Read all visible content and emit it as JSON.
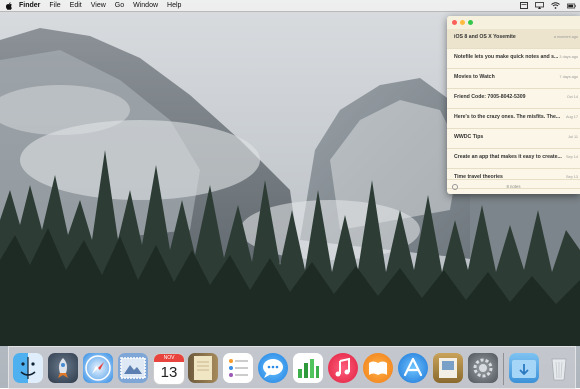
{
  "menubar": {
    "app_name": "Finder",
    "menus": [
      "File",
      "Edit",
      "View",
      "Go",
      "Window",
      "Help"
    ]
  },
  "notefile": {
    "notes": [
      {
        "title": "iOS 8 and OS X Yosemite",
        "date": "a moment ago"
      },
      {
        "title": "Notefile lets you make quick notes and s...",
        "date": "3 days ago"
      },
      {
        "title": "Movies to Watch",
        "date": "7 days ago"
      },
      {
        "title": "Friend Code: 7005-8042-5309",
        "date": "Oct 14"
      },
      {
        "title": "Here's to the crazy ones. The misfits. The...",
        "date": "Aug 17"
      },
      {
        "title": "WWDC Tips",
        "date": "Jul 11"
      },
      {
        "title": "Create an app that makes it easy to create...",
        "date": "Sep 14"
      },
      {
        "title": "Time travel theories",
        "date": "Sep 13"
      }
    ],
    "count_text": "8 notes"
  },
  "dock": {
    "calendar": {
      "month": "NOV",
      "day": "13"
    }
  },
  "colors": {
    "menubar": "#f0f0f0",
    "note_background": "#fbf6e7",
    "selected_note": "#ece4cd"
  }
}
